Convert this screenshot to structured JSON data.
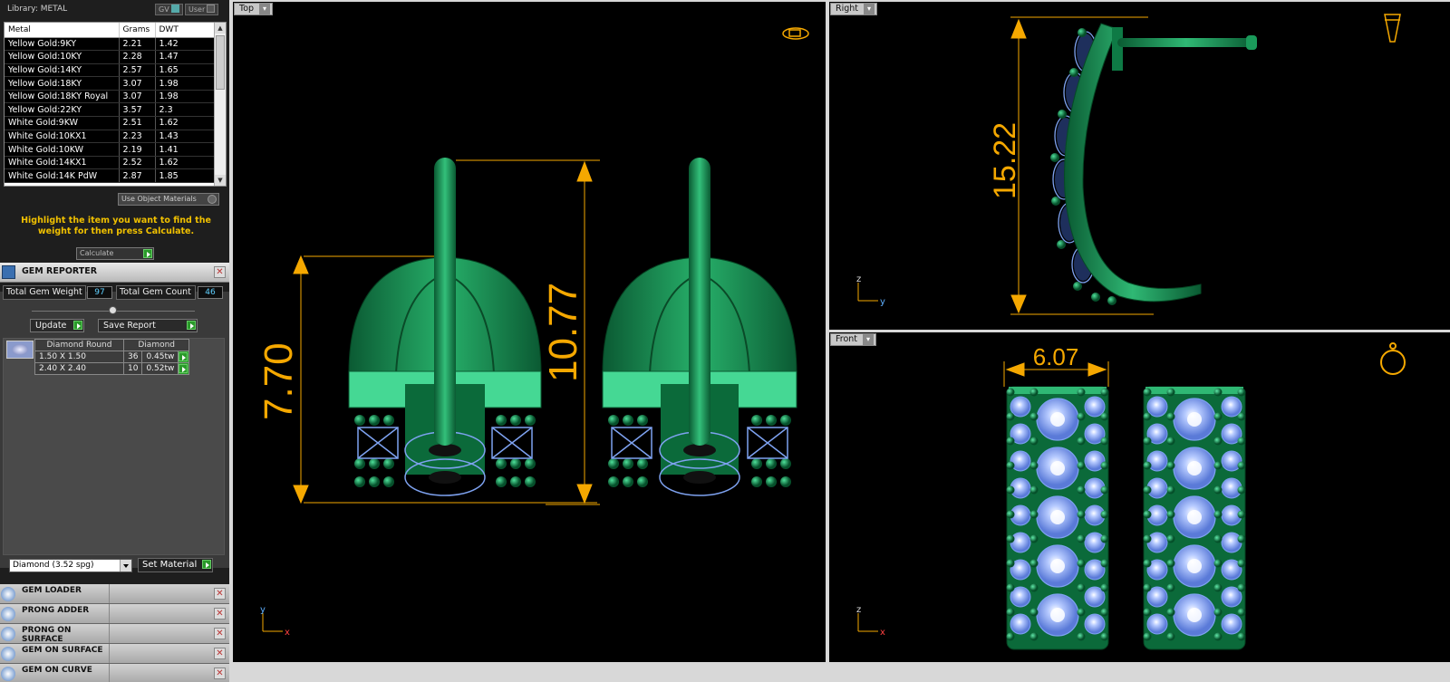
{
  "library": {
    "title": "Library: METAL",
    "chip_gv": "GV",
    "chip_user": "User",
    "columns": [
      "Metal",
      "Grams",
      "DWT"
    ],
    "rows": [
      [
        "Yellow Gold:9KY",
        "2.21",
        "1.42"
      ],
      [
        "Yellow Gold:10KY",
        "2.28",
        "1.47"
      ],
      [
        "Yellow Gold:14KY",
        "2.57",
        "1.65"
      ],
      [
        "Yellow Gold:18KY",
        "3.07",
        "1.98"
      ],
      [
        "Yellow Gold:18KY Royal",
        "3.07",
        "1.98"
      ],
      [
        "Yellow Gold:22KY",
        "3.57",
        "2.3"
      ],
      [
        "White Gold:9KW",
        "2.51",
        "1.62"
      ],
      [
        "White Gold:10KX1",
        "2.23",
        "1.43"
      ],
      [
        "White Gold:10KW",
        "2.19",
        "1.41"
      ],
      [
        "White Gold:14KX1",
        "2.52",
        "1.62"
      ],
      [
        "White Gold:14K PdW",
        "2.87",
        "1.85"
      ]
    ],
    "use_object_materials": "Use Object Materials",
    "hint": "Highlight the item you want to find the weight for then press Calculate.",
    "calculate": "Calculate"
  },
  "gem_reporter": {
    "title": "GEM REPORTER",
    "total_weight_label": "Total Gem Weight",
    "total_weight_value": "97",
    "total_count_label": "Total Gem Count",
    "total_count_value": "46",
    "update": "Update",
    "save_report": "Save Report",
    "table_header": [
      "Diamond Round",
      "Diamond"
    ],
    "table_rows": [
      [
        "1.50 X 1.50",
        "36",
        "0.45tw"
      ],
      [
        "2.40 X 2.40",
        "10",
        "0.52tw"
      ]
    ],
    "material_select": "Diamond    (3.52 spg)",
    "set_material": "Set Material"
  },
  "panels": [
    {
      "title": "GEM LOADER",
      "icon": "gem-loader-icon"
    },
    {
      "title": "PRONG ADDER",
      "icon": "prong-adder-icon"
    },
    {
      "title": "PRONG ON SURFACE",
      "icon": "prong-surface-icon"
    },
    {
      "title": "GEM ON SURFACE",
      "icon": "gem-surface-icon"
    },
    {
      "title": "GEM ON CURVE",
      "icon": "gem-curve-icon"
    }
  ],
  "viewports": {
    "top": {
      "label": "Top",
      "dims": [
        "7.70",
        "10.77"
      ],
      "axis_y": "y",
      "axis_x": "x"
    },
    "right": {
      "label": "Right",
      "dims": [
        "15.22"
      ],
      "axis_z": "z",
      "axis_y": "y"
    },
    "front": {
      "label": "Front",
      "dims": [
        "6.07"
      ],
      "axis_z": "z",
      "axis_x": "x"
    }
  },
  "colors": {
    "metal": "#0e7a45",
    "metal_light": "#3fd08a",
    "gem": "#7ea2f0",
    "dimension": "#f5a800"
  }
}
